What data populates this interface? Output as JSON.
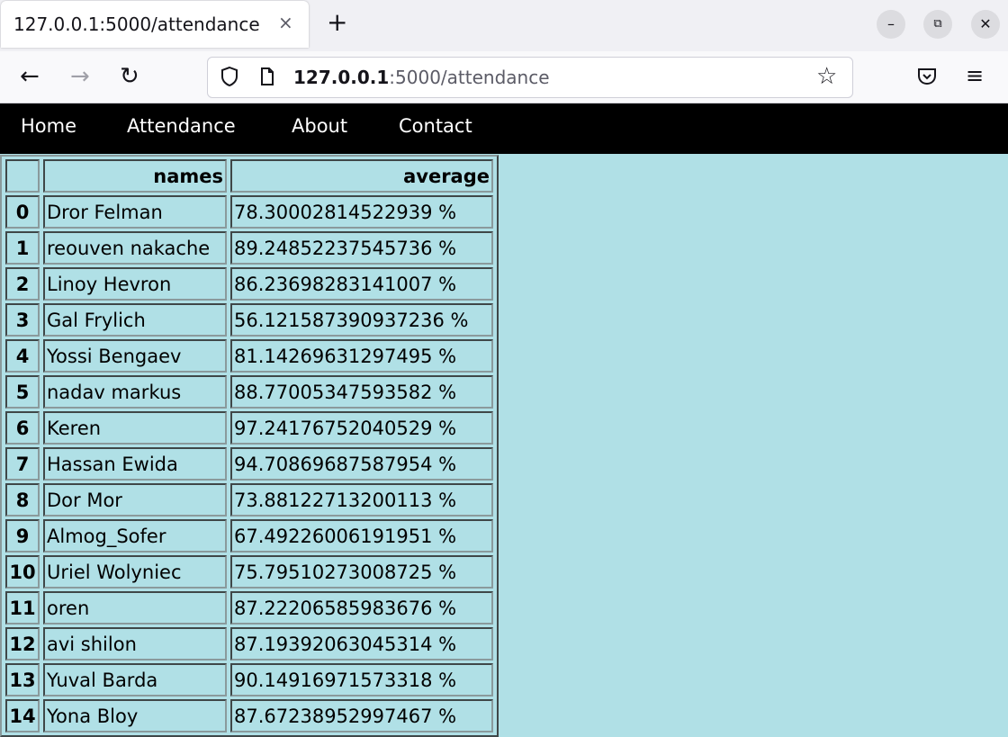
{
  "browser": {
    "tab_title": "127.0.0.1:5000/attendance",
    "tab_close": "×",
    "new_tab": "+",
    "url_host": "127.0.0.1",
    "url_rest": ":5000/attendance",
    "window_controls": [
      "–",
      "⧉",
      "✕"
    ]
  },
  "site_nav": {
    "items": [
      "Home",
      "Attendance",
      "About",
      "Contact"
    ]
  },
  "table": {
    "headers": [
      "",
      "names",
      "average"
    ],
    "rows": [
      {
        "index": "0",
        "name": "Dror Felman",
        "average": "78.30002814522939 %"
      },
      {
        "index": "1",
        "name": "reouven nakache",
        "average": "89.24852237545736 %"
      },
      {
        "index": "2",
        "name": "Linoy Hevron",
        "average": "86.23698283141007 %"
      },
      {
        "index": "3",
        "name": "Gal Frylich",
        "average": "56.121587390937236 %"
      },
      {
        "index": "4",
        "name": "Yossi Bengaev",
        "average": "81.14269631297495 %"
      },
      {
        "index": "5",
        "name": "nadav markus",
        "average": "88.77005347593582 %"
      },
      {
        "index": "6",
        "name": "Keren",
        "average": "97.24176752040529 %"
      },
      {
        "index": "7",
        "name": "Hassan Ewida",
        "average": "94.70869687587954 %"
      },
      {
        "index": "8",
        "name": "Dor Mor",
        "average": "73.88122713200113 %"
      },
      {
        "index": "9",
        "name": "Almog_Sofer",
        "average": "67.49226006191951 %"
      },
      {
        "index": "10",
        "name": "Uriel Wolyniec",
        "average": "75.79510273008725 %"
      },
      {
        "index": "11",
        "name": "oren",
        "average": "87.22206585983676 %"
      },
      {
        "index": "12",
        "name": "avi shilon",
        "average": "87.19392063045314 %"
      },
      {
        "index": "13",
        "name": "Yuval Barda",
        "average": "90.14916971573318 %"
      },
      {
        "index": "14",
        "name": "Yona Bloy",
        "average": "87.67238952997467 %"
      }
    ]
  },
  "colors": {
    "page_background": "#b0e0e6",
    "nav_background": "#000000",
    "nav_text": "#ffffff"
  }
}
